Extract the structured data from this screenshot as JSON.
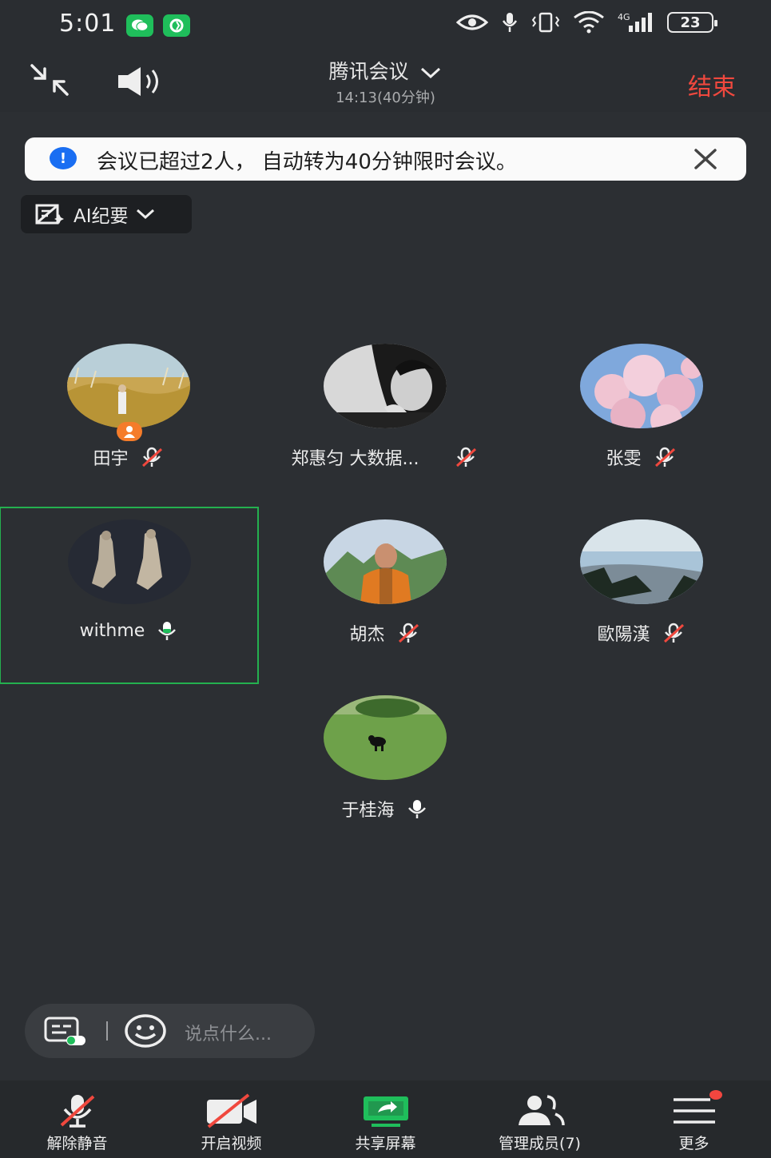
{
  "status_bar": {
    "time": "5:01",
    "battery": "23",
    "app_icons": [
      "wechat-icon",
      "green-app-icon"
    ],
    "indicators": [
      "eye-icon",
      "mic-icon",
      "vibrate-icon",
      "wifi-icon",
      "cellular-4g-icon"
    ]
  },
  "header": {
    "title": "腾讯会议",
    "time": "14:13(40分钟)",
    "end_label": "结束",
    "colors": {
      "end": "#f0483e"
    }
  },
  "notice": {
    "text": "会议已超过2人， 自动转为40分钟限时会议。",
    "info_icon_color": "#1a6ef2"
  },
  "ai_summary": {
    "label": "AI纪要"
  },
  "participants": [
    {
      "name": "田宇",
      "mic": "muted",
      "host": true
    },
    {
      "name": "郑惠匀 大数据...",
      "mic": "muted",
      "host": false
    },
    {
      "name": "张雯",
      "mic": "muted",
      "host": false
    },
    {
      "name": "withme",
      "mic": "on",
      "host": false,
      "active_speaker": true
    },
    {
      "name": "胡杰",
      "mic": "muted",
      "host": false
    },
    {
      "name": "歐陽漢",
      "mic": "muted",
      "host": false
    },
    {
      "name": "于桂海",
      "mic": "on",
      "host": false
    }
  ],
  "chat": {
    "placeholder": "说点什么..."
  },
  "toolbar": {
    "unmute": "解除静音",
    "video": "开启视频",
    "share": "共享屏幕",
    "members": "管理成员(7)",
    "more": "更多",
    "colors": {
      "share_icon": "#1fbe5b",
      "notify_dot": "#f1463f"
    }
  }
}
